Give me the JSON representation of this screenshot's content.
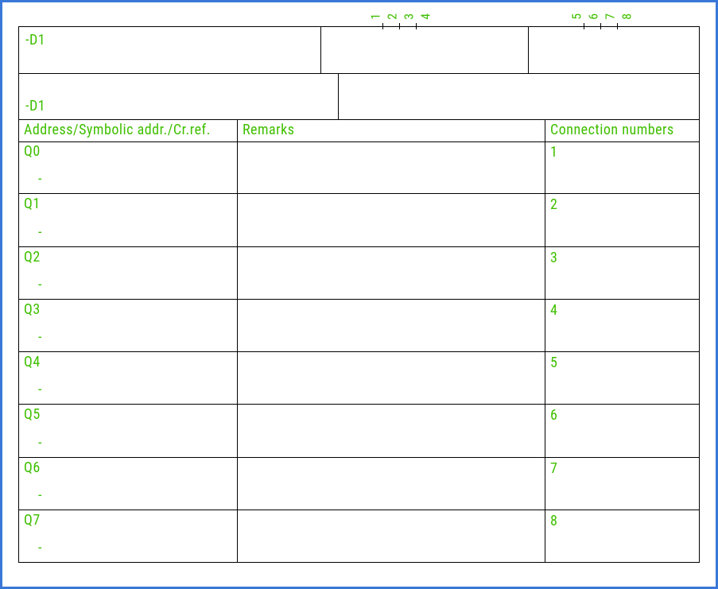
{
  "pin_labels_left": [
    "1",
    "2",
    "3",
    "4"
  ],
  "pin_labels_right": [
    "5",
    "6",
    "7",
    "8"
  ],
  "header1": {
    "c1": "-D1",
    "c2": "",
    "c3": ""
  },
  "header2": {
    "c1": "-D1",
    "c2": ""
  },
  "columns": {
    "address": "Address/Symbolic addr./Cr.ref.",
    "remarks": "Remarks",
    "conn": "Connection numbers"
  },
  "rows": [
    {
      "address": "Q0",
      "sub": "-",
      "remarks": "",
      "conn": "1"
    },
    {
      "address": "Q1",
      "sub": "-",
      "remarks": "",
      "conn": "2"
    },
    {
      "address": "Q2",
      "sub": "-",
      "remarks": "",
      "conn": "3"
    },
    {
      "address": "Q3",
      "sub": "-",
      "remarks": "",
      "conn": "4"
    },
    {
      "address": "Q4",
      "sub": "-",
      "remarks": "",
      "conn": "5"
    },
    {
      "address": "Q5",
      "sub": "-",
      "remarks": "",
      "conn": "6"
    },
    {
      "address": "Q6",
      "sub": "-",
      "remarks": "",
      "conn": "7"
    },
    {
      "address": "Q7",
      "sub": "-",
      "remarks": "",
      "conn": "8"
    }
  ]
}
